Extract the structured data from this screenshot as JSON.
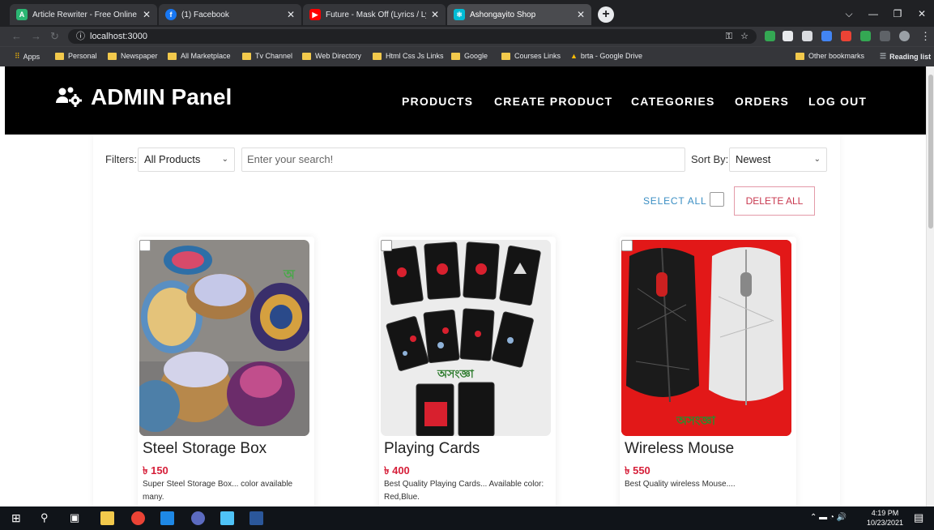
{
  "browser": {
    "tabs": [
      {
        "title": "Article Rewriter - Free Online Art",
        "favicon_color": "#2bb673",
        "active": false
      },
      {
        "title": "(1) Facebook",
        "favicon_color": "#1877f2",
        "active": false
      },
      {
        "title": "Future - Mask Off (Lyrics / Lyric V",
        "favicon_color": "#ff0000",
        "active": false
      },
      {
        "title": "Ashongayito Shop",
        "favicon_color": "#00bcd4",
        "active": true
      }
    ],
    "url": "localhost:3000",
    "bookmarks": [
      "Apps",
      "Personal",
      "Newspaper",
      "All Marketplace",
      "Tv Channel",
      "Web Directory",
      "Html Css Js Links",
      "Google",
      "Courses Links",
      "brta - Google Drive"
    ],
    "other_bookmarks": "Other bookmarks",
    "reading_list": "Reading list"
  },
  "header": {
    "brand": "ADMIN Panel",
    "menu": [
      "PRODUCTS",
      "CREATE PRODUCT",
      "CATEGORIES",
      "ORDERS",
      "LOG OUT"
    ]
  },
  "toolbar": {
    "filters_label": "Filters:",
    "filter_value": "All Products",
    "search_placeholder": "Enter your search!",
    "sort_label": "Sort By:",
    "sort_value": "Newest",
    "select_all": "SELECT ALL",
    "delete_all": "DELETE ALL"
  },
  "products": [
    {
      "name": "Steel Storage Box",
      "price": "৳ 150",
      "description": "Super Steel Storage Box... color available many."
    },
    {
      "name": "Playing Cards",
      "price": "৳ 400",
      "description": "Best Quality Playing Cards... Available color: Red,Blue."
    },
    {
      "name": "Wireless Mouse",
      "price": "৳ 550",
      "description": "Best Quality wireless Mouse...."
    }
  ],
  "taskbar": {
    "time": "4:19 PM",
    "date": "10/23/2021"
  },
  "colors": {
    "accent_red": "#d6203a",
    "link_blue": "#3a8ec3",
    "header_bg": "#000000"
  }
}
